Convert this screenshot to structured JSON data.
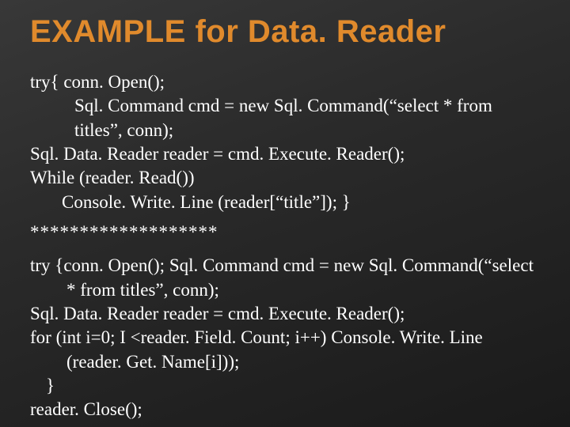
{
  "title": "EXAMPLE for Data. Reader",
  "block1": {
    "l1": "try{ conn. Open();",
    "l2": "Sql. Command cmd = new Sql. Command(“select * from titles”, conn);",
    "l3": "Sql. Data. Reader reader = cmd. Execute. Reader();",
    "l4": "While (reader. Read())",
    "l5": "Console. Write. Line (reader[“title”]); }"
  },
  "divider": "*******************",
  "block2": {
    "l1": "try {conn. Open(); Sql. Command cmd = new Sql. Command(“select * from titles”, conn);",
    "l2": "Sql. Data. Reader reader = cmd. Execute. Reader();",
    "l3": "for (int i=0; I <reader. Field. Count; i++) Console. Write. Line (reader. Get. Name[i]));",
    "l4": "}",
    "l5": "reader. Close();"
  }
}
